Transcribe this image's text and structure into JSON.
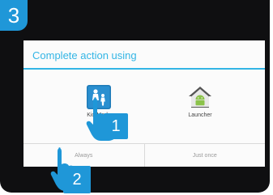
{
  "step_number": "3",
  "dialog": {
    "title": "Complete action using",
    "apps": [
      {
        "label": "Kid Mode",
        "icon": "kid-mode-icon"
      },
      {
        "label": "Launcher",
        "icon": "android-launcher-icon"
      }
    ],
    "buttons": {
      "always": "Always",
      "just_once": "Just once"
    }
  },
  "callouts": [
    "1",
    "2"
  ],
  "colors": {
    "accent": "#33b5e5",
    "callout": "#1f97d8",
    "screen": "#0f0f11"
  }
}
